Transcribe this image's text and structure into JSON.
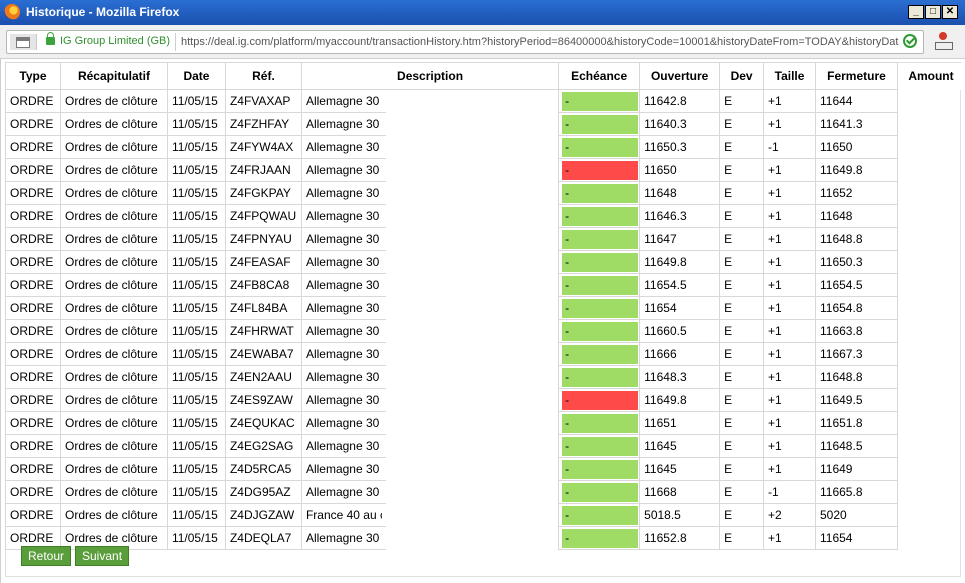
{
  "window": {
    "title": "Historique - Mozilla Firefox",
    "minimize": "_",
    "maximize": "□",
    "close": "✕"
  },
  "urlbar": {
    "identity": "IG Group Limited (GB)",
    "url": "https://deal.ig.com/platform/myaccount/transactionHistory.htm?historyPeriod=86400000&historyCode=10001&historyDateFrom=TODAY&historyDat"
  },
  "table": {
    "headers": {
      "type": "Type",
      "recap": "Récapitulatif",
      "date": "Date",
      "ref": "Réf.",
      "description": "Description",
      "echeance": "Echéance",
      "ouverture": "Ouverture",
      "dev": "Dev",
      "taille": "Taille",
      "fermeture": "Fermeture",
      "amount": "Amount"
    },
    "rows": [
      {
        "type": "ORDRE",
        "recap": "Ordres de clôture",
        "date": "11/05/15",
        "ref": "Z4FVAXAP",
        "desc": "Allemagne 30",
        "ech": "-",
        "ech_color": "#9fdc66",
        "ouverture": "11642.8",
        "dev": "E",
        "taille": "+1",
        "fermeture": "11644"
      },
      {
        "type": "ORDRE",
        "recap": "Ordres de clôture",
        "date": "11/05/15",
        "ref": "Z4FZHFAY",
        "desc": "Allemagne 30",
        "ech": "-",
        "ech_color": "#9fdc66",
        "ouverture": "11640.3",
        "dev": "E",
        "taille": "+1",
        "fermeture": "11641.3"
      },
      {
        "type": "ORDRE",
        "recap": "Ordres de clôture",
        "date": "11/05/15",
        "ref": "Z4FYW4AX",
        "desc": "Allemagne 30",
        "ech": "-",
        "ech_color": "#9fdc66",
        "ouverture": "11650.3",
        "dev": "E",
        "taille": "-1",
        "fermeture": "11650"
      },
      {
        "type": "ORDRE",
        "recap": "Ordres de clôture",
        "date": "11/05/15",
        "ref": "Z4FRJAAN",
        "desc": "Allemagne 30",
        "ech": "-",
        "ech_color": "#ff4a4a",
        "ouverture": "11650",
        "dev": "E",
        "taille": "+1",
        "fermeture": "11649.8"
      },
      {
        "type": "ORDRE",
        "recap": "Ordres de clôture",
        "date": "11/05/15",
        "ref": "Z4FGKPAY",
        "desc": "Allemagne 30",
        "ech": "-",
        "ech_color": "#9fdc66",
        "ouverture": "11648",
        "dev": "E",
        "taille": "+1",
        "fermeture": "11652"
      },
      {
        "type": "ORDRE",
        "recap": "Ordres de clôture",
        "date": "11/05/15",
        "ref": "Z4FPQWAU",
        "desc": "Allemagne 30",
        "ech": "-",
        "ech_color": "#9fdc66",
        "ouverture": "11646.3",
        "dev": "E",
        "taille": "+1",
        "fermeture": "11648"
      },
      {
        "type": "ORDRE",
        "recap": "Ordres de clôture",
        "date": "11/05/15",
        "ref": "Z4FPNYAU",
        "desc": "Allemagne 30",
        "ech": "-",
        "ech_color": "#9fdc66",
        "ouverture": "11647",
        "dev": "E",
        "taille": "+1",
        "fermeture": "11648.8"
      },
      {
        "type": "ORDRE",
        "recap": "Ordres de clôture",
        "date": "11/05/15",
        "ref": "Z4FEASAF",
        "desc": "Allemagne 30",
        "ech": "-",
        "ech_color": "#9fdc66",
        "ouverture": "11649.8",
        "dev": "E",
        "taille": "+1",
        "fermeture": "11650.3"
      },
      {
        "type": "ORDRE",
        "recap": "Ordres de clôture",
        "date": "11/05/15",
        "ref": "Z4FB8CA8",
        "desc": "Allemagne 30",
        "ech": "-",
        "ech_color": "#9fdc66",
        "ouverture": "11654.5",
        "dev": "E",
        "taille": "+1",
        "fermeture": "11654.5"
      },
      {
        "type": "ORDRE",
        "recap": "Ordres de clôture",
        "date": "11/05/15",
        "ref": "Z4FL84BA",
        "desc": "Allemagne 30",
        "ech": "-",
        "ech_color": "#9fdc66",
        "ouverture": "11654",
        "dev": "E",
        "taille": "+1",
        "fermeture": "11654.8"
      },
      {
        "type": "ORDRE",
        "recap": "Ordres de clôture",
        "date": "11/05/15",
        "ref": "Z4FHRWAT",
        "desc": "Allemagne 30",
        "ech": "-",
        "ech_color": "#9fdc66",
        "ouverture": "11660.5",
        "dev": "E",
        "taille": "+1",
        "fermeture": "11663.8"
      },
      {
        "type": "ORDRE",
        "recap": "Ordres de clôture",
        "date": "11/05/15",
        "ref": "Z4EWABA7",
        "desc": "Allemagne 30",
        "ech": "-",
        "ech_color": "#9fdc66",
        "ouverture": "11666",
        "dev": "E",
        "taille": "+1",
        "fermeture": "11667.3"
      },
      {
        "type": "ORDRE",
        "recap": "Ordres de clôture",
        "date": "11/05/15",
        "ref": "Z4EN2AAU",
        "desc": "Allemagne 30",
        "ech": "-",
        "ech_color": "#9fdc66",
        "ouverture": "11648.3",
        "dev": "E",
        "taille": "+1",
        "fermeture": "11648.8"
      },
      {
        "type": "ORDRE",
        "recap": "Ordres de clôture",
        "date": "11/05/15",
        "ref": "Z4ES9ZAW",
        "desc": "Allemagne 30",
        "ech": "-",
        "ech_color": "#ff4a4a",
        "ouverture": "11649.8",
        "dev": "E",
        "taille": "+1",
        "fermeture": "11649.5"
      },
      {
        "type": "ORDRE",
        "recap": "Ordres de clôture",
        "date": "11/05/15",
        "ref": "Z4EQUKAC",
        "desc": "Allemagne 30",
        "ech": "-",
        "ech_color": "#9fdc66",
        "ouverture": "11651",
        "dev": "E",
        "taille": "+1",
        "fermeture": "11651.8"
      },
      {
        "type": "ORDRE",
        "recap": "Ordres de clôture",
        "date": "11/05/15",
        "ref": "Z4EG2SAG",
        "desc": "Allemagne 30",
        "ech": "-",
        "ech_color": "#9fdc66",
        "ouverture": "11645",
        "dev": "E",
        "taille": "+1",
        "fermeture": "11648.5"
      },
      {
        "type": "ORDRE",
        "recap": "Ordres de clôture",
        "date": "11/05/15",
        "ref": "Z4D5RCA5",
        "desc": "Allemagne 30",
        "ech": "-",
        "ech_color": "#9fdc66",
        "ouverture": "11645",
        "dev": "E",
        "taille": "+1",
        "fermeture": "11649"
      },
      {
        "type": "ORDRE",
        "recap": "Ordres de clôture",
        "date": "11/05/15",
        "ref": "Z4DG95AZ",
        "desc": "Allemagne 30",
        "ech": "-",
        "ech_color": "#9fdc66",
        "ouverture": "11668",
        "dev": "E",
        "taille": "-1",
        "fermeture": "11665.8"
      },
      {
        "type": "ORDRE",
        "recap": "Ordres de clôture",
        "date": "11/05/15",
        "ref": "Z4DJGZAW",
        "desc": "France 40 au c",
        "ech": "-",
        "ech_color": "#9fdc66",
        "ouverture": "5018.5",
        "dev": "E",
        "taille": "+2",
        "fermeture": "5020"
      },
      {
        "type": "ORDRE",
        "recap": "Ordres de clôture",
        "date": "11/05/15",
        "ref": "Z4DEQLA7",
        "desc": "Allemagne 30",
        "ech": "-",
        "ech_color": "#9fdc66",
        "ouverture": "11652.8",
        "dev": "E",
        "taille": "+1",
        "fermeture": "11654"
      }
    ]
  },
  "buttons": {
    "retour": "Retour",
    "suivant": "Suivant"
  }
}
